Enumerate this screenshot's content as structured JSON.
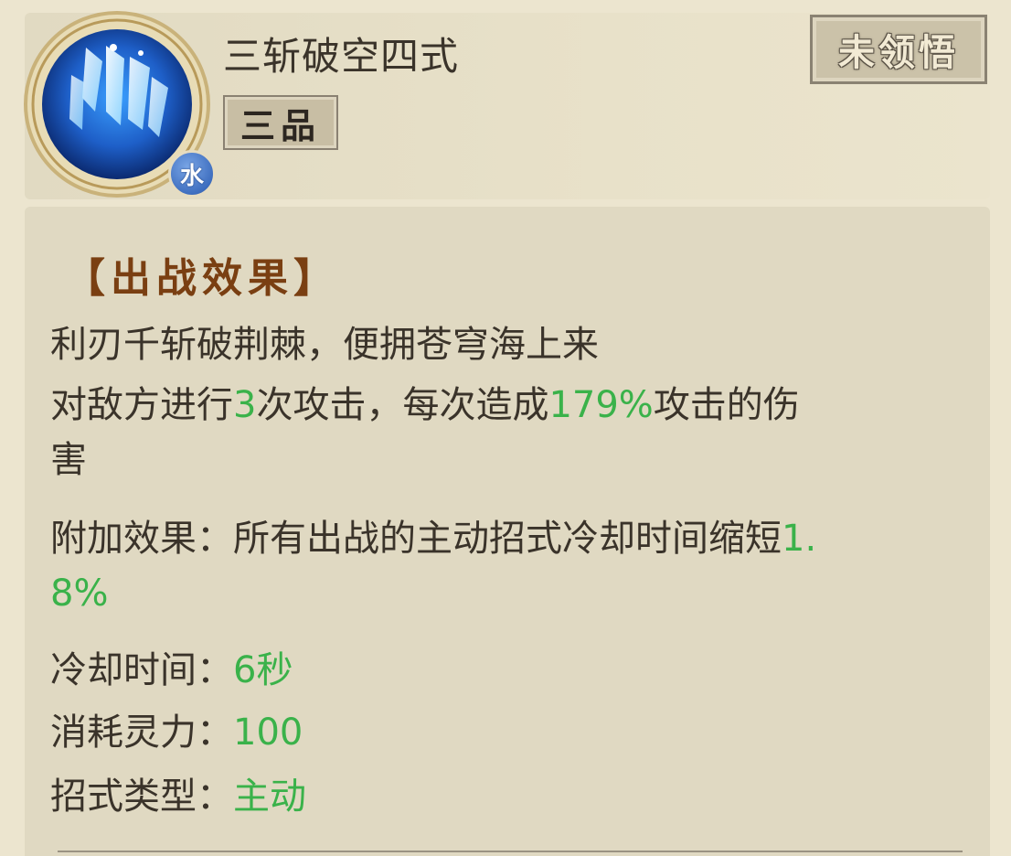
{
  "skill": {
    "name": "三斩破空四式",
    "grade": "三品",
    "status": "未领悟",
    "element": "水",
    "icon": "ice-shards-icon"
  },
  "effects": {
    "section_title": "【出战效果】",
    "poem": "利刃千斩破荆棘，便拥苍穹海上来",
    "attack_prefix": "对敌方进行",
    "attack_count": "3",
    "attack_mid": "次攻击，每次造成",
    "attack_percent": "179%",
    "attack_suffix_line1": "攻击的伤",
    "attack_suffix_line2": "害",
    "extra_label": "附加效果：所有出战的主动招式冷却时间缩短",
    "extra_value_line1": "1.",
    "extra_value_line2": "8%",
    "cooldown_label": "冷却时间：",
    "cooldown_value": "6秒",
    "cost_label": "消耗灵力：",
    "cost_value": "100",
    "type_label": "招式类型：",
    "type_value": "主动"
  },
  "colors": {
    "highlight": "#3ab24a",
    "section_title": "#7a3f12",
    "background": "#ece5cf"
  }
}
